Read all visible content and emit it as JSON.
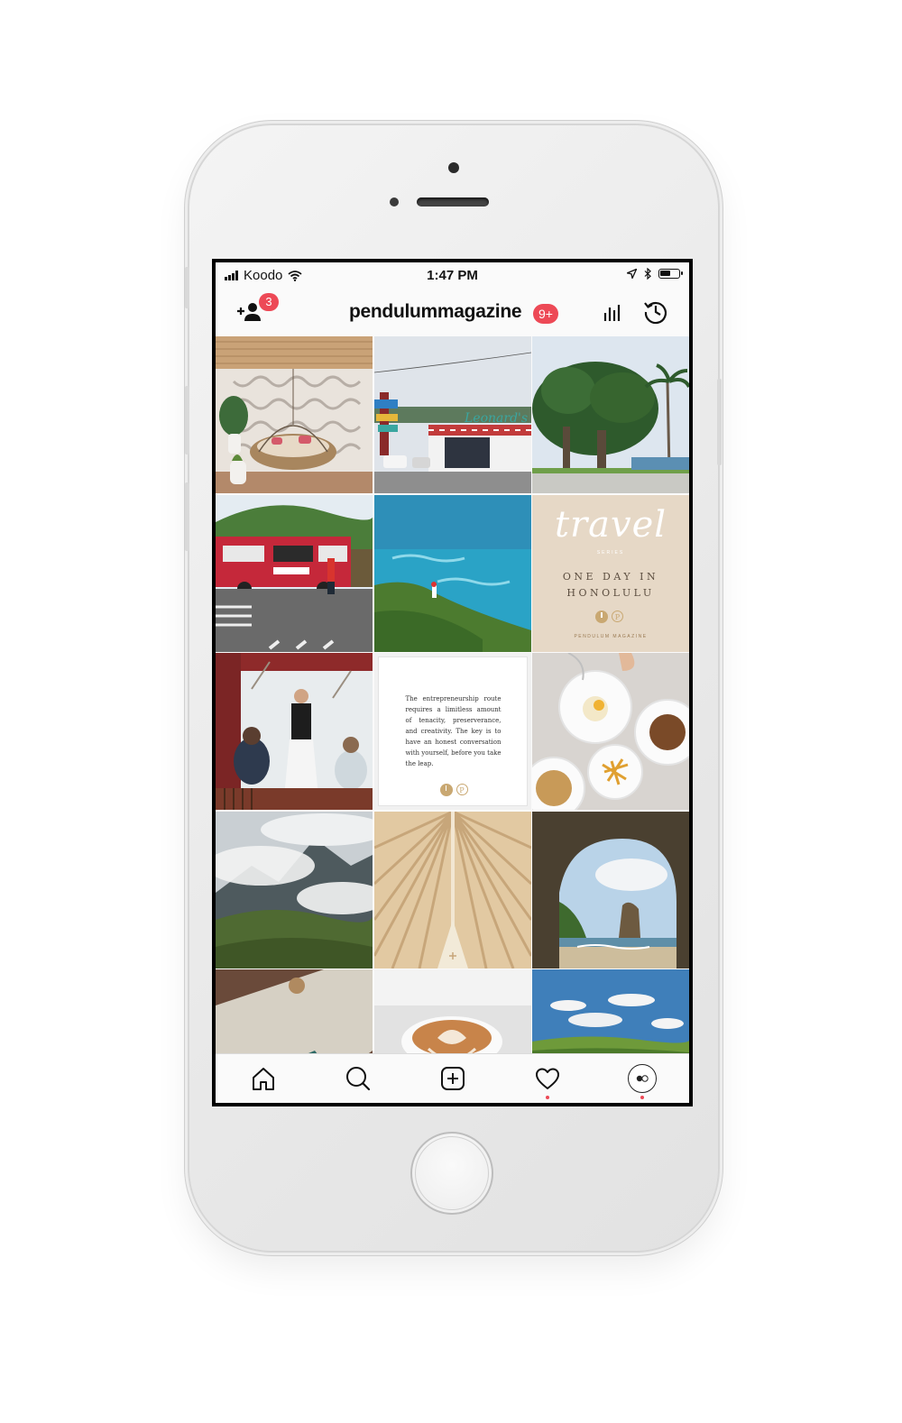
{
  "status_bar": {
    "carrier": "Koodo",
    "time": "1:47 PM"
  },
  "header": {
    "username": "pendulummagazine",
    "notifications_badge": "9+",
    "follow_requests_badge": "3"
  },
  "grid": {
    "tiles": [
      {
        "name": "tile-lobby-swing-chair",
        "kind": "photo"
      },
      {
        "name": "tile-street-storefront",
        "kind": "photo"
      },
      {
        "name": "tile-banyan-park",
        "kind": "photo"
      },
      {
        "name": "tile-shave-ice-truck",
        "kind": "photo"
      },
      {
        "name": "tile-coastline-lighthouse",
        "kind": "photo"
      },
      {
        "name": "tile-travel-series-card",
        "kind": "travel"
      },
      {
        "name": "tile-restaurant-waiter",
        "kind": "photo"
      },
      {
        "name": "tile-quote-card",
        "kind": "quote"
      },
      {
        "name": "tile-brunch-table",
        "kind": "photo"
      },
      {
        "name": "tile-cloudy-mountains",
        "kind": "photo"
      },
      {
        "name": "tile-wooden-ceiling",
        "kind": "photo"
      },
      {
        "name": "tile-sea-cave-arch",
        "kind": "photo"
      },
      {
        "name": "tile-leather-wallet",
        "kind": "photo"
      },
      {
        "name": "tile-latte-art",
        "kind": "photo"
      },
      {
        "name": "tile-green-hills-sky",
        "kind": "photo"
      }
    ],
    "travel_card": {
      "script": "travel",
      "series": "SERIES",
      "line1": "ONE DAY IN",
      "line2": "HONOLULU",
      "logo_letter": "P",
      "footer": "PENDULUM MAGAZINE"
    },
    "quote_card": {
      "text": "The entrepreneurship route requires a limitless amount of tenacity, preserverance, and creativity. The key is to have an honest conversation with yourself, before you take the leap.",
      "logo_letter": "P"
    }
  },
  "tab_bar": {
    "items": [
      {
        "name": "tab-home",
        "icon": "home-icon"
      },
      {
        "name": "tab-search",
        "icon": "search-icon"
      },
      {
        "name": "tab-new-post",
        "icon": "plus-square-icon"
      },
      {
        "name": "tab-activity",
        "icon": "heart-icon",
        "has_dot": true
      },
      {
        "name": "tab-profile",
        "icon": "profile-avatar-icon",
        "has_dot": true
      }
    ]
  },
  "colors": {
    "badge_red": "#ed4956",
    "travel_card_bg": "#e6d8c6",
    "gold_accent": "#c9a872"
  }
}
